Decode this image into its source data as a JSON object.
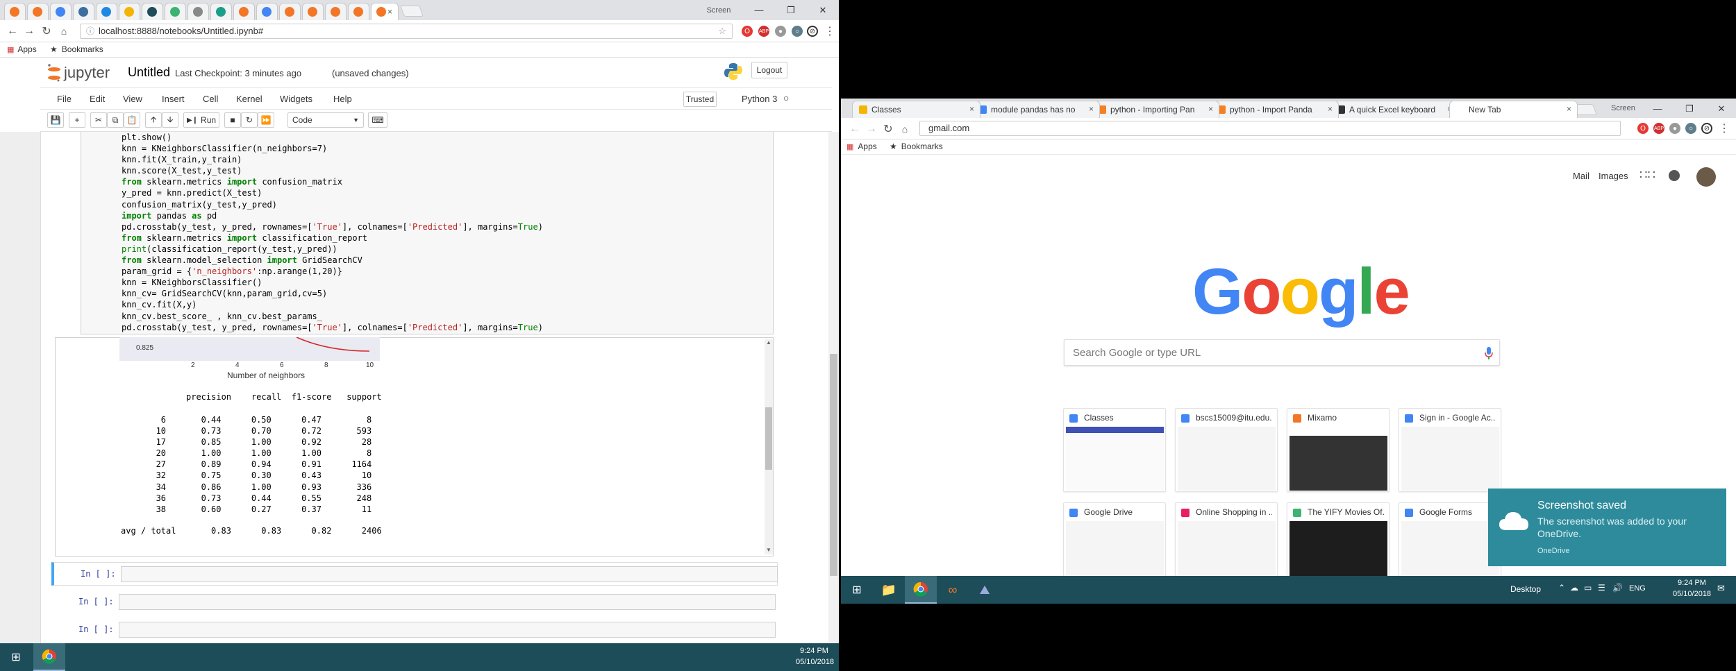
{
  "left_window": {
    "tabs": [
      {
        "fav_color": "#f37626"
      },
      {
        "fav_color": "#f37626"
      },
      {
        "fav_color": "#4285f4"
      },
      {
        "fav_color": "#3c6e9e"
      },
      {
        "fav_color": "#1e88e5"
      },
      {
        "fav_color": "#f4b400"
      },
      {
        "fav_color": "#1e4d5a"
      },
      {
        "fav_color": "#3cb371"
      },
      {
        "fav_color": "#888888"
      },
      {
        "fav_color": "#1a9e8a"
      },
      {
        "fav_color": "#f37626"
      },
      {
        "fav_color": "#4285f4"
      },
      {
        "fav_color": "#f37626"
      },
      {
        "fav_color": "#f37626"
      },
      {
        "fav_color": "#f37626"
      },
      {
        "fav_color": "#f37626"
      },
      {
        "fav_color": "#f37626"
      }
    ],
    "active_tab_close": "×",
    "window_title": "Screen",
    "address_url": "localhost:8888/notebooks/Untitled.ipynb#",
    "bookmarks": {
      "apps": "Apps",
      "bookmarks": "Bookmarks"
    },
    "jupyter": {
      "logo_text": "jupyter",
      "notebook_name": "Untitled",
      "checkpoint": "Last Checkpoint: 3 minutes ago",
      "unsaved": "(unsaved changes)",
      "logout": "Logout",
      "menu": [
        "File",
        "Edit",
        "View",
        "Insert",
        "Cell",
        "Kernel",
        "Widgets",
        "Help"
      ],
      "trusted": "Trusted",
      "kernel": "Python 3",
      "toolbar": {
        "run": "Run",
        "cell_type": "Code"
      }
    },
    "code_lines": [
      [
        {
          "t": "plt.show()",
          "c": ""
        }
      ],
      [
        {
          "t": "knn = KNeighborsClassifier(n_neighbors=7)",
          "c": ""
        }
      ],
      [
        {
          "t": "knn.fit(X_train,y_train)",
          "c": ""
        }
      ],
      [
        {
          "t": "knn.score(X_test,y_test)",
          "c": ""
        }
      ],
      [
        {
          "t": "from",
          "c": "kw"
        },
        {
          "t": " sklearn.metrics ",
          "c": ""
        },
        {
          "t": "import",
          "c": "kw"
        },
        {
          "t": " confusion_matrix",
          "c": ""
        }
      ],
      [
        {
          "t": "y_pred = knn.predict(X_test)",
          "c": ""
        }
      ],
      [
        {
          "t": "confusion_matrix(y_test,y_pred)",
          "c": ""
        }
      ],
      [
        {
          "t": "import",
          "c": "kw"
        },
        {
          "t": " pandas ",
          "c": ""
        },
        {
          "t": "as",
          "c": "kw"
        },
        {
          "t": " pd",
          "c": ""
        }
      ],
      [
        {
          "t": "pd.crosstab(y_test, y_pred, rownames=[",
          "c": ""
        },
        {
          "t": "'True'",
          "c": "st"
        },
        {
          "t": "], colnames=[",
          "c": ""
        },
        {
          "t": "'Predicted'",
          "c": "st"
        },
        {
          "t": "], margins=",
          "c": ""
        },
        {
          "t": "True",
          "c": "nm"
        },
        {
          "t": ")",
          "c": ""
        }
      ],
      [
        {
          "t": "from",
          "c": "kw"
        },
        {
          "t": " sklearn.metrics ",
          "c": ""
        },
        {
          "t": "import",
          "c": "kw"
        },
        {
          "t": " classification_report",
          "c": ""
        }
      ],
      [
        {
          "t": "print",
          "c": "nm"
        },
        {
          "t": "(classification_report(y_test,y_pred))",
          "c": ""
        }
      ],
      [
        {
          "t": "from",
          "c": "kw"
        },
        {
          "t": " sklearn.model_selection ",
          "c": ""
        },
        {
          "t": "import",
          "c": "kw"
        },
        {
          "t": " GridSearchCV",
          "c": ""
        }
      ],
      [
        {
          "t": "param_grid = {",
          "c": ""
        },
        {
          "t": "'n_neighbors'",
          "c": "st"
        },
        {
          "t": ":np.arange(1,20)}",
          "c": ""
        }
      ],
      [
        {
          "t": "knn = KNeighborsClassifier()",
          "c": ""
        }
      ],
      [
        {
          "t": "knn_cv= GridSearchCV(knn,param_grid,cv=5)",
          "c": ""
        }
      ],
      [
        {
          "t": "knn_cv.fit(X,y)",
          "c": ""
        }
      ],
      [
        {
          "t": "knn_cv.best_score_ , knn_cv.best_params_",
          "c": ""
        }
      ],
      [
        {
          "t": "pd.crosstab(y_test, y_pred, rownames=[",
          "c": ""
        },
        {
          "t": "'True'",
          "c": "st"
        },
        {
          "t": "], colnames=[",
          "c": ""
        },
        {
          "t": "'Predicted'",
          "c": "st"
        },
        {
          "t": "], margins=",
          "c": ""
        },
        {
          "t": "True",
          "c": "nm"
        },
        {
          "t": ")",
          "c": ""
        }
      ]
    ],
    "plot_partial": {
      "y_tick": "0.825",
      "x_ticks": [
        "2",
        "4",
        "6",
        "8",
        "10"
      ],
      "xlabel": "Number of neighbors"
    },
    "report": {
      "header": "precision    recall  f1-score   support",
      "rows": [
        "        6       0.44      0.50      0.47         8",
        "       10       0.73      0.70      0.72       593",
        "       17       0.85      1.00      0.92        28",
        "       20       1.00      1.00      1.00         8",
        "       27       0.89      0.94      0.91      1164",
        "       32       0.75      0.30      0.43        10",
        "       34       0.86      1.00      0.93       336",
        "       36       0.73      0.44      0.55       248",
        "       38       0.60      0.27      0.37        11"
      ],
      "avg": "avg / total       0.83      0.83      0.82      2406"
    },
    "input_prompt": "In [ ]:",
    "taskbar": {
      "time": "9:24 PM",
      "date": "05/10/2018"
    }
  },
  "right_window": {
    "tabs": [
      {
        "title": "Classes",
        "fav_color": "#f4b400"
      },
      {
        "title": "module pandas has no",
        "fav_color": "#4285f4"
      },
      {
        "title": "python - Importing Pan",
        "fav_color": "#f48024"
      },
      {
        "title": "python - Import Panda",
        "fav_color": "#f48024"
      },
      {
        "title": "A quick Excel keyboard",
        "fav_color": "#333333"
      },
      {
        "title": "New Tab",
        "fav_color": "#ffffff"
      }
    ],
    "window_title": "Screen",
    "address_url": "gmail.com",
    "bookmarks": {
      "apps": "Apps",
      "bookmarks": "Bookmarks"
    },
    "top_links": {
      "mail": "Mail",
      "images": "Images"
    },
    "google_letters": [
      {
        "ch": "G",
        "color": "#4285f4"
      },
      {
        "ch": "o",
        "color": "#ea4335"
      },
      {
        "ch": "o",
        "color": "#fbbc05"
      },
      {
        "ch": "g",
        "color": "#4285f4"
      },
      {
        "ch": "l",
        "color": "#34a853"
      },
      {
        "ch": "e",
        "color": "#ea4335"
      }
    ],
    "search_placeholder": "Search Google or type URL",
    "tiles": [
      {
        "title": "Classes",
        "fav_color": "#4285f4"
      },
      {
        "title": "bscs15009@itu.edu...",
        "fav_color": "#4285f4"
      },
      {
        "title": "Mixamo",
        "fav_color": "#f37626"
      },
      {
        "title": "Sign in - Google Ac...",
        "fav_color": "#4285f4"
      },
      {
        "title": "Google Drive",
        "fav_color": "#4285f4"
      },
      {
        "title": "Online Shopping in ...",
        "fav_color": "#e91e63"
      },
      {
        "title": "The YIFY Movies Of...",
        "fav_color": "#3cb371"
      },
      {
        "title": "Google Forms",
        "fav_color": "#4285f4"
      }
    ],
    "toast": {
      "title": "Screenshot saved",
      "body": "The screenshot was added to your OneDrive.",
      "source": "OneDrive"
    },
    "taskbar": {
      "desktop": "Desktop",
      "lang": "ENG",
      "time": "9:24 PM",
      "date": "05/10/2018"
    }
  }
}
